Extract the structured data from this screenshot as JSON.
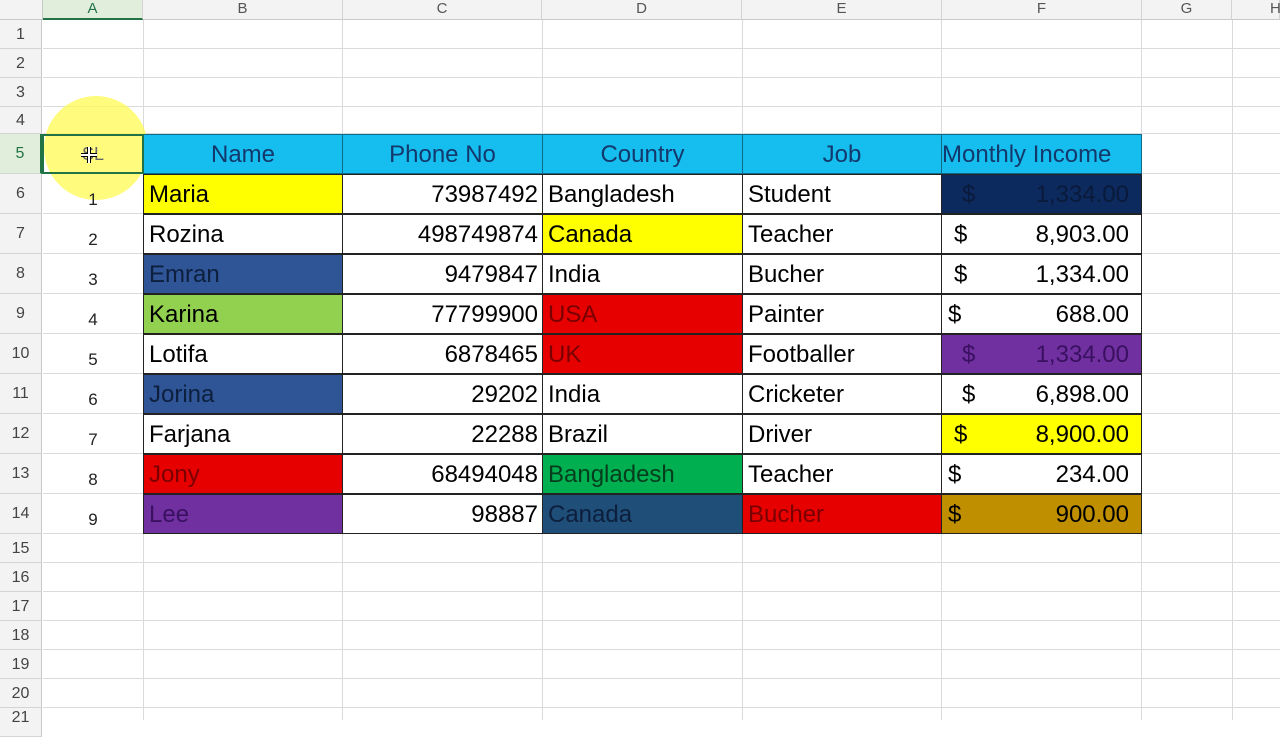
{
  "columns": [
    "A",
    "B",
    "C",
    "D",
    "E",
    "F",
    "G",
    "H"
  ],
  "rows": [
    "1",
    "2",
    "3",
    "4",
    "5",
    "6",
    "7",
    "8",
    "9",
    "10",
    "11",
    "12",
    "13",
    "14",
    "15",
    "16",
    "17",
    "18",
    "19",
    "20",
    "21"
  ],
  "selected_column": "A",
  "selected_row": "5",
  "table": {
    "headers": {
      "sl": "SL",
      "name": "Name",
      "phone": "Phone No",
      "country": "Country",
      "job": "Job",
      "income": "Monthly Income"
    },
    "currency_symbol": "$",
    "records": [
      {
        "sl": "1",
        "name": "Maria",
        "phone": "73987492",
        "country": "Bangladesh",
        "job": "Student",
        "income": "1,334.00"
      },
      {
        "sl": "2",
        "name": "Rozina",
        "phone": "498749874",
        "country": "Canada",
        "job": "Teacher",
        "income": "8,903.00"
      },
      {
        "sl": "3",
        "name": "Emran",
        "phone": "9479847",
        "country": "India",
        "job": "Bucher",
        "income": "1,334.00"
      },
      {
        "sl": "4",
        "name": "Karina",
        "phone": "77799900",
        "country": "USA",
        "job": "Painter",
        "income": "688.00"
      },
      {
        "sl": "5",
        "name": "Lotifa",
        "phone": "6878465",
        "country": "UK",
        "job": "Footballer",
        "income": "1,334.00"
      },
      {
        "sl": "6",
        "name": "Jorina",
        "phone": "29202",
        "country": "India",
        "job": "Cricketer",
        "income": "6,898.00"
      },
      {
        "sl": "7",
        "name": "Farjana",
        "phone": "22288",
        "country": "Brazil",
        "job": "Driver",
        "income": "8,900.00"
      },
      {
        "sl": "8",
        "name": "Jony",
        "phone": "68494048",
        "country": "Bangladesh",
        "job": "Teacher",
        "income": "234.00"
      },
      {
        "sl": "9",
        "name": "Lee",
        "phone": "98887",
        "country": "Canada",
        "job": "Bucher",
        "income": "900.00"
      }
    ]
  },
  "colors": {
    "header_fill": "#16bdef",
    "yellow": "#ffff00",
    "navy": "#0d2a5e",
    "blue": "#2f5597",
    "green_light": "#92d050",
    "red": "#e60000",
    "purple": "#7030a0",
    "green": "#00b050",
    "teal_blue": "#1f4e79",
    "gold": "#bf8f00"
  }
}
